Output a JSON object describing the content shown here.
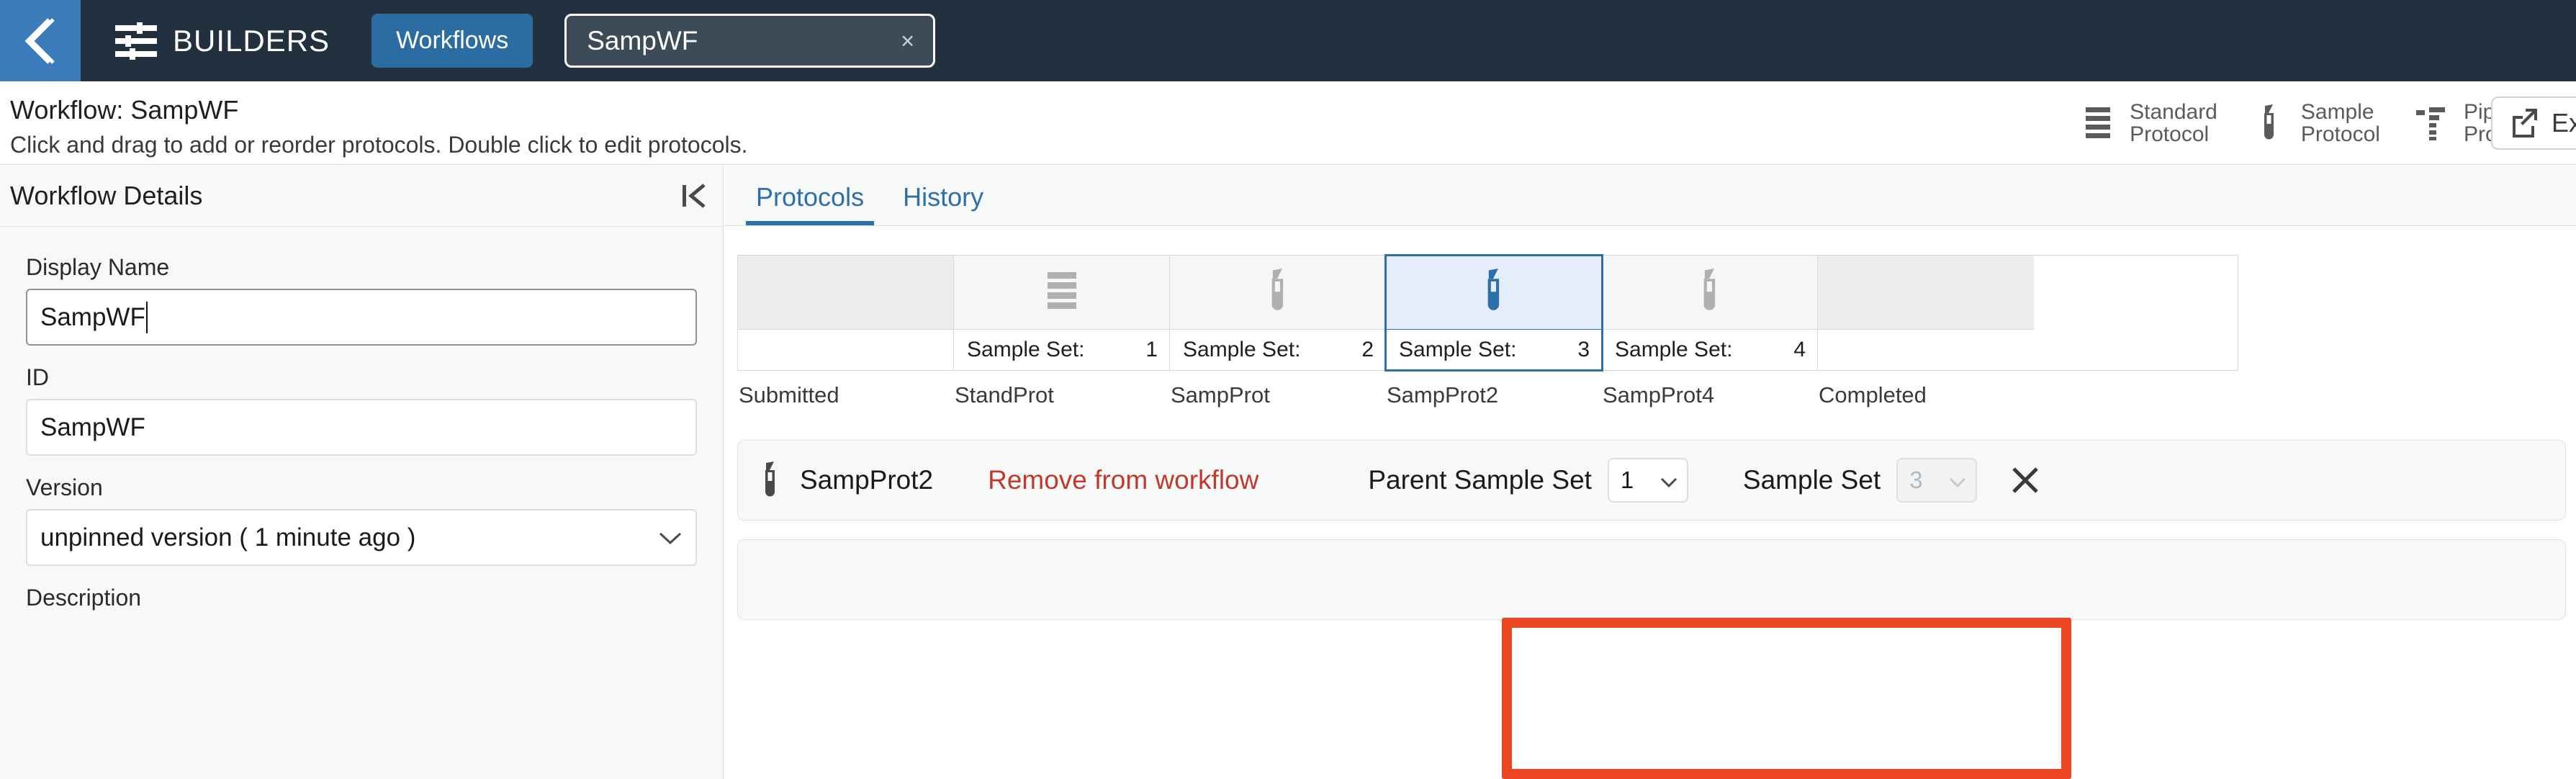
{
  "topbar": {
    "back_icon": "chevron-left-icon",
    "app_icon": "sliders-icon",
    "app_name": "BUILDERS",
    "nav_tab": "Workflows",
    "open_chip": {
      "label": "SampWF",
      "close": "×"
    }
  },
  "header": {
    "title": "Workflow: SampWF",
    "subtitle": "Click and drag to add or reorder protocols. Double click to edit protocols.",
    "actions": [
      {
        "icon": "standard-protocol-icon",
        "line1": "Standard",
        "line2": "Protocol"
      },
      {
        "icon": "sample-protocol-icon",
        "line1": "Sample",
        "line2": "Protocol"
      },
      {
        "icon": "pipeline-protocol-icon",
        "line1": "Pipeline",
        "line2": "Protocol"
      }
    ],
    "export": {
      "icon": "external-link-icon",
      "label": "Exp"
    }
  },
  "sidebar": {
    "title": "Workflow Details",
    "collapse_icon": "collapse-panel-icon",
    "fields": {
      "display_name_label": "Display Name",
      "display_name_value": "SampWF",
      "id_label": "ID",
      "id_value": "SampWF",
      "version_label": "Version",
      "version_value": "unpinned version ( 1 minute ago )",
      "description_label": "Description"
    }
  },
  "main": {
    "tabs": [
      {
        "label": "Protocols",
        "active": true
      },
      {
        "label": "History",
        "active": false
      }
    ],
    "flow": {
      "sample_set_label": "Sample Set:",
      "columns": [
        {
          "name": "Submitted",
          "icon": "none",
          "sample_set": "",
          "kind": "endcap",
          "selected": false
        },
        {
          "name": "StandProt",
          "icon": "standard-protocol-icon",
          "sample_set": "1",
          "kind": "protocol",
          "selected": false
        },
        {
          "name": "SampProt",
          "icon": "sample-protocol-icon",
          "sample_set": "2",
          "kind": "protocol",
          "selected": false
        },
        {
          "name": "SampProt2",
          "icon": "sample-protocol-icon",
          "sample_set": "3",
          "kind": "protocol",
          "selected": true
        },
        {
          "name": "SampProt4",
          "icon": "sample-protocol-icon",
          "sample_set": "4",
          "kind": "protocol",
          "selected": false
        },
        {
          "name": "Completed",
          "icon": "none",
          "sample_set": "",
          "kind": "endcap",
          "selected": false
        }
      ]
    },
    "protocol_row": {
      "icon": "sample-protocol-icon",
      "name": "SampProt2",
      "remove_label": "Remove from workflow",
      "parent_label": "Parent Sample Set",
      "parent_value": "1",
      "sample_set_label": "Sample Set",
      "sample_set_value": "3",
      "close_icon": "close-icon"
    }
  },
  "colors": {
    "topbar_bg": "#22303f",
    "back_btn_bg": "#3a7cb9",
    "accent_blue": "#2d6fa8",
    "tab_active_blue": "#2b6ca3",
    "remove_red": "#c0392b",
    "highlight_red": "#ec4524",
    "selected_cell_bg": "#e4eefa"
  }
}
